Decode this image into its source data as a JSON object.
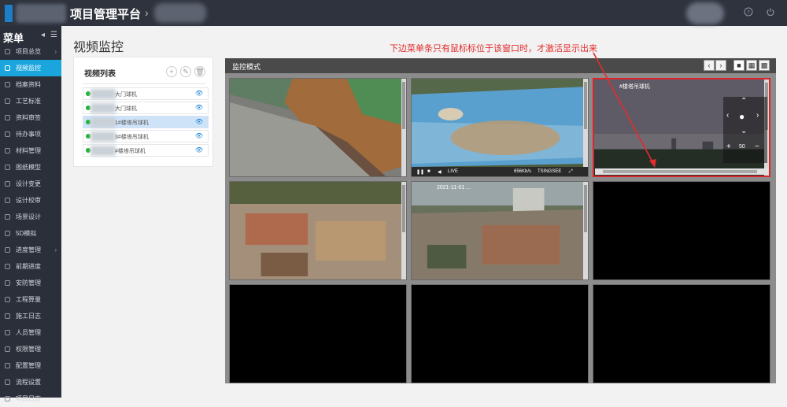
{
  "header": {
    "app_title": "项目管理平台",
    "crumb_arrow": "›",
    "help_icon": "question-icon",
    "power_icon": "power-icon"
  },
  "sidebar": {
    "title": "菜单",
    "items": [
      {
        "label": "项目总览",
        "has_arrow": true
      },
      {
        "label": "视频监控",
        "active": true
      },
      {
        "label": "档案资料"
      },
      {
        "label": "工艺标准"
      },
      {
        "label": "资料审签"
      },
      {
        "label": "待办事项"
      },
      {
        "label": "材料管理"
      },
      {
        "label": "图纸模型"
      },
      {
        "label": "设计变更"
      },
      {
        "label": "设计校审"
      },
      {
        "label": "场景设计"
      },
      {
        "label": "5D模拟"
      },
      {
        "label": "进度管理",
        "has_arrow": true
      },
      {
        "label": "前期进度"
      },
      {
        "label": "安防管理"
      },
      {
        "label": "工程算量"
      },
      {
        "label": "施工日志"
      },
      {
        "label": "人员管理"
      },
      {
        "label": "权限管理"
      },
      {
        "label": "配置管理"
      },
      {
        "label": "流程设置"
      },
      {
        "label": "项目日志"
      }
    ]
  },
  "main": {
    "page_title": "视频监控",
    "list": {
      "title": "视频列表",
      "cameras": [
        {
          "name": "大门球机"
        },
        {
          "name": "大门球机"
        },
        {
          "name": "1#楼塔吊球机",
          "selected": true
        },
        {
          "name": "3#楼塔吊球机"
        },
        {
          "name": "#楼塔吊球机"
        }
      ]
    }
  },
  "monitor": {
    "title": "监控模式",
    "prev": "‹",
    "next": "›",
    "cells": [
      {
        "scene": "site1",
        "label": ""
      },
      {
        "scene": "roof",
        "label": "",
        "has_controls": true,
        "controls": {
          "live": "LIVE",
          "bitrate": "656Kb/s",
          "brand": "TSINGSEE"
        }
      },
      {
        "scene": "sky",
        "label": "#楼塔吊球机",
        "selected": true,
        "ptz_zoom": "50"
      },
      {
        "scene": "site2",
        "label": ""
      },
      {
        "scene": "site3",
        "label": "2021-11-01 ..."
      },
      {
        "scene": "black"
      },
      {
        "scene": "black"
      },
      {
        "scene": "black"
      },
      {
        "scene": "black"
      }
    ]
  },
  "annotation": {
    "text": "下边菜单条只有鼠标标位于该窗口时，才激活显示出来",
    "color": "#e22c2c"
  }
}
